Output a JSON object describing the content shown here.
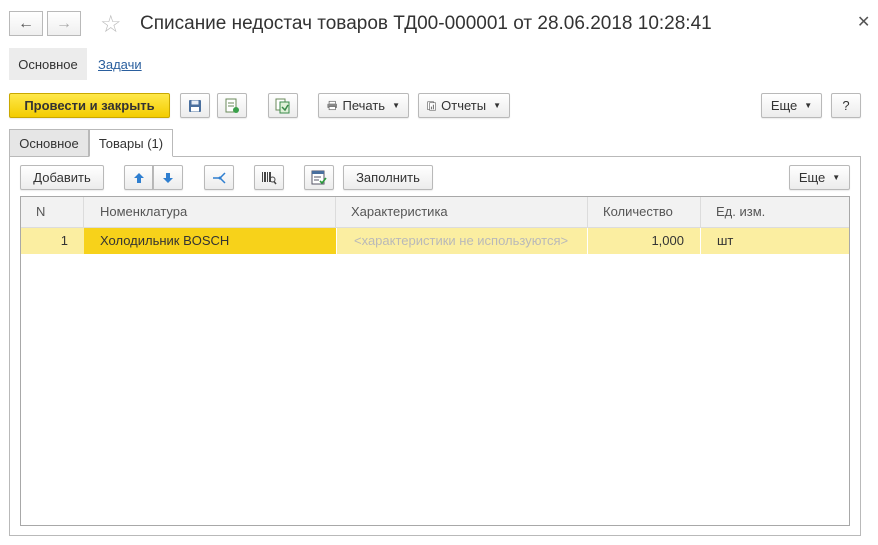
{
  "window": {
    "title": "Списание недостач товаров ТД00-000001 от 28.06.2018 10:28:41"
  },
  "sections": {
    "main": "Основное",
    "tasks": "Задачи"
  },
  "toolbar": {
    "post_close": "Провести и закрыть",
    "print": "Печать",
    "reports": "Отчеты",
    "more": "Еще",
    "help": "?"
  },
  "tabs": [
    {
      "label": "Основное"
    },
    {
      "label": "Товары (1)"
    }
  ],
  "grid_toolbar": {
    "add": "Добавить",
    "fill": "Заполнить",
    "more": "Еще"
  },
  "table": {
    "columns": [
      "N",
      "Номенклатура",
      "Характеристика",
      "Количество",
      "Ед. изм."
    ],
    "rows": [
      {
        "n": "1",
        "item": "Холодильник BOSCH",
        "characteristic": "<характеристики не используются>",
        "quantity": "1,000",
        "unit": "шт"
      }
    ]
  },
  "colors": {
    "accent_yellow": "#f5d000",
    "row_highlight": "#fbeea1",
    "link": "#2a5f9e"
  }
}
